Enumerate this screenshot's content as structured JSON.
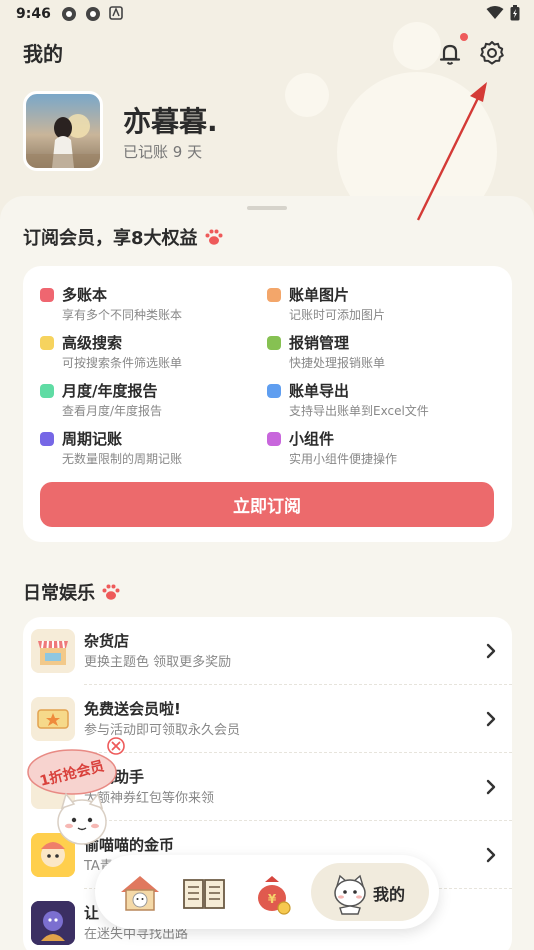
{
  "status_bar": {
    "time": "9:46"
  },
  "header": {
    "title": "我的"
  },
  "profile": {
    "name": "亦暮暮.",
    "days_text": "已记账 9 天"
  },
  "membership": {
    "title": "订阅会员，享8大权益",
    "benefits": [
      {
        "title": "多账本",
        "desc": "享有多个不同种类账本",
        "color": "#ef6670"
      },
      {
        "title": "账单图片",
        "desc": "记账时可添加图片",
        "color": "#f3a66a"
      },
      {
        "title": "高级搜索",
        "desc": "可按搜索条件筛选账单",
        "color": "#f6d35e"
      },
      {
        "title": "报销管理",
        "desc": "快捷处理报销账单",
        "color": "#86c152"
      },
      {
        "title": "月度/年度报告",
        "desc": "查看月度/年度报告",
        "color": "#5fdca4"
      },
      {
        "title": "账单导出",
        "desc": "支持导出账单到Excel文件",
        "color": "#5f9ef0"
      },
      {
        "title": "周期记账",
        "desc": "无数量限制的周期记账",
        "color": "#7667e6"
      },
      {
        "title": "小组件",
        "desc": "实用小组件便捷操作",
        "color": "#c866dc"
      }
    ],
    "subscribe_label": "立即订阅",
    "accent": "#ec6a6c"
  },
  "entertainment": {
    "title": "日常娱乐",
    "items": [
      {
        "title": "杂货店",
        "desc": "更换主题色 领取更多奖励",
        "icon": "shop-icon"
      },
      {
        "title": "免费送会员啦!",
        "desc": "参与活动即可领取永久会员",
        "icon": "ticket-icon"
      },
      {
        "title": "省钱助手",
        "desc": "大额神券红包等你来领",
        "icon": "coupon-icon"
      },
      {
        "title": "偷喵喵的金币",
        "desc": "TA青",
        "icon": "cat-game-icon"
      },
      {
        "title": "让",
        "desc": "在迷失中寻找出路",
        "icon": "maze-game-icon"
      }
    ]
  },
  "promo": {
    "text": "1折抢会员"
  },
  "bottom_nav": {
    "items": [
      {
        "icon": "home-cat-icon"
      },
      {
        "icon": "ledger-book-icon"
      },
      {
        "icon": "money-bag-icon"
      },
      {
        "icon": "cat-profile-icon",
        "label": "我的"
      }
    ]
  }
}
